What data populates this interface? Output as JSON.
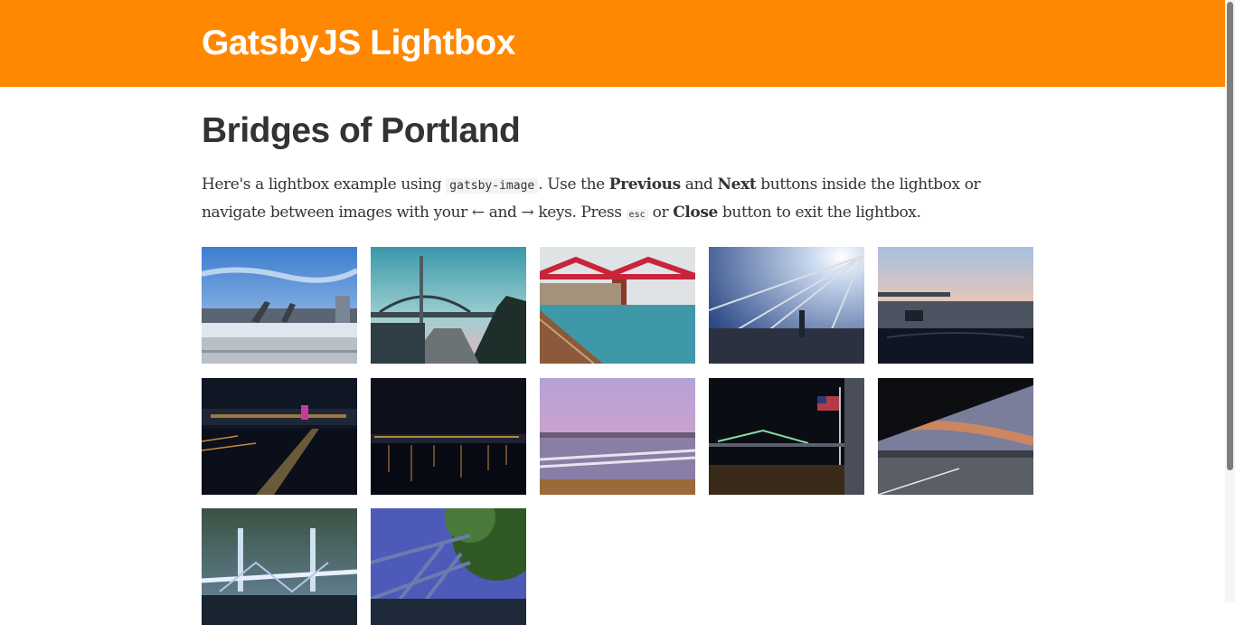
{
  "header": {
    "site_title": "GatsbyJS Lightbox",
    "background_color": "#ff8800"
  },
  "main": {
    "title": "Bridges of Portland",
    "intro": {
      "t1": "Here's a lightbox example using ",
      "code": "gatsby-image",
      "t2": ". Use the ",
      "previous": "Previous",
      "t3": " and ",
      "next": "Next",
      "t4": " buttons inside the lightbox or navigate between images with your ← and → keys. Press ",
      "key_esc": "esc",
      "t5": " or ",
      "close": "Close",
      "t6": " button to exit the lightbox."
    }
  },
  "gallery": {
    "thumbnails": [
      {
        "scene": "daytime-bridge-skyline"
      },
      {
        "scene": "arch-bridge-at-dusk"
      },
      {
        "scene": "red-steel-bridge-over-water"
      },
      {
        "scene": "cable-stay-bridge-sun-flare"
      },
      {
        "scene": "freeway-sunset-from-car"
      },
      {
        "scene": "night-city-waterfront"
      },
      {
        "scene": "night-river-reflections"
      },
      {
        "scene": "marina-purple-sky"
      },
      {
        "scene": "flag-and-lit-bridge-night"
      },
      {
        "scene": "sunset-clouds-under-overpass"
      },
      {
        "scene": "lit-lift-bridge-dusk"
      },
      {
        "scene": "steel-truss-bridge-with-tree"
      }
    ]
  }
}
